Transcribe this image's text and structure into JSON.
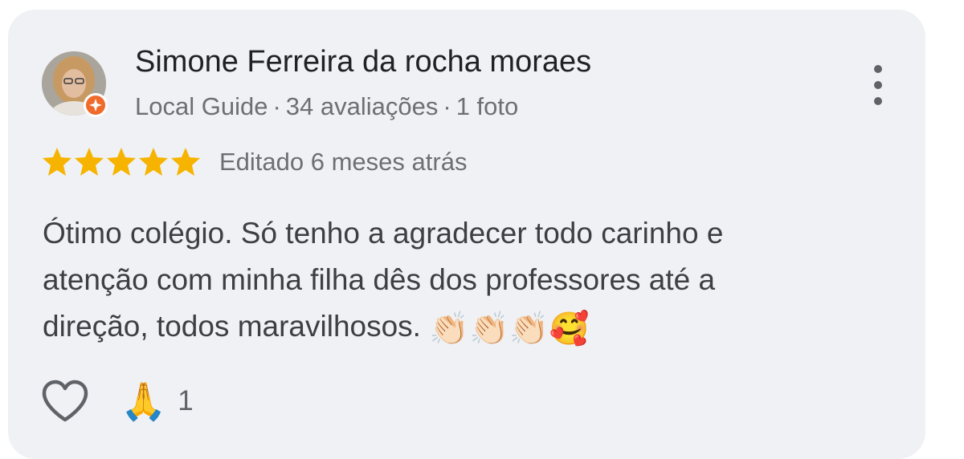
{
  "reviewer": {
    "name": "Simone Ferreira da rocha moraes",
    "badge": "Local Guide",
    "separator": "·",
    "reviews_count": "34 avaliações",
    "photos_count": "1 foto"
  },
  "rating": {
    "stars": 5,
    "star_color": "#f6b400",
    "edited_label": "Editado 6 meses atrás"
  },
  "review": {
    "lines": [
      "Ótimo colégio. Só tenho a agradecer todo carinho e",
      "atenção com minha filha dês dos professores até a",
      "direção, todos maravilhosos."
    ],
    "emojis": "👏🏻👏🏻👏🏻🥰"
  },
  "actions": {
    "like_icon": "heart-outline-icon",
    "reaction_emoji": "🙏",
    "reaction_count": "1"
  },
  "icons": {
    "more": "more-vertical-icon",
    "badge": "local-guide-badge-icon"
  },
  "colors": {
    "card_bg": "#f0f1f4",
    "local_guide_badge": "#f06a2b"
  }
}
